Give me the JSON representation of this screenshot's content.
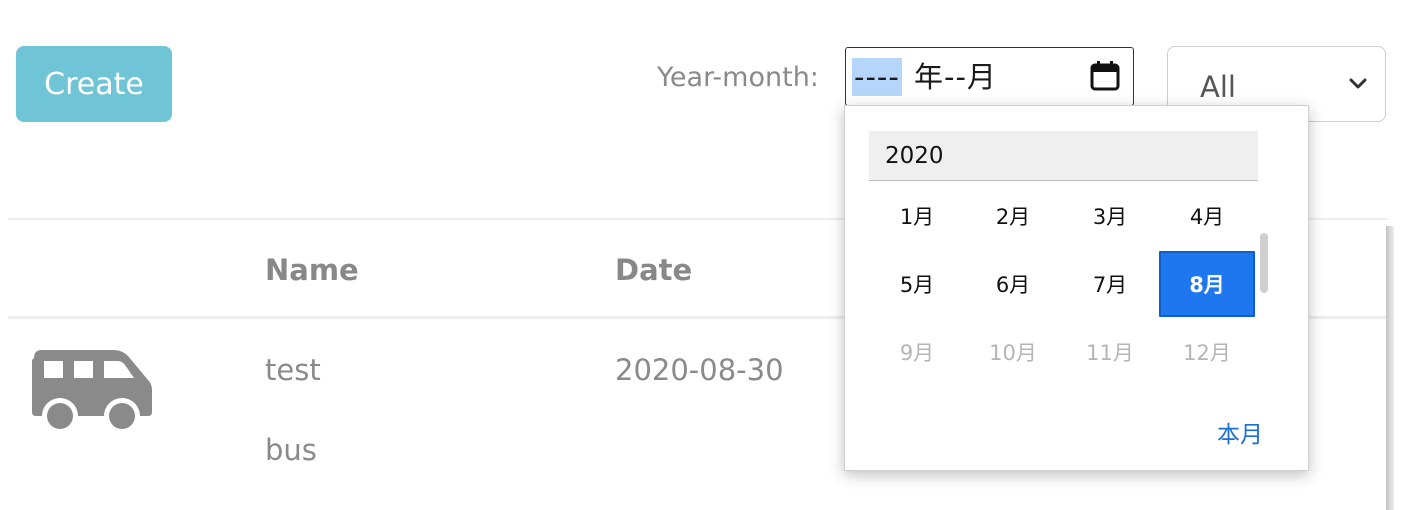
{
  "toolbar": {
    "create_label": "Create",
    "year_month_label": "Year-month:",
    "month_input": {
      "year_segment": "----",
      "rest_segments": "年--月"
    },
    "filter_select": {
      "selected": "All"
    }
  },
  "table": {
    "columns": [
      "",
      "Name",
      "Date"
    ],
    "rows": [
      {
        "icon": "bus-icon",
        "name": "test",
        "date": "2020-08-30",
        "type": "bus"
      }
    ]
  },
  "month_picker": {
    "year": "2020",
    "months": [
      {
        "label": "1月",
        "state": "normal"
      },
      {
        "label": "2月",
        "state": "normal"
      },
      {
        "label": "3月",
        "state": "normal"
      },
      {
        "label": "4月",
        "state": "normal"
      },
      {
        "label": "5月",
        "state": "normal"
      },
      {
        "label": "6月",
        "state": "normal"
      },
      {
        "label": "7月",
        "state": "normal"
      },
      {
        "label": "8月",
        "state": "selected"
      },
      {
        "label": "9月",
        "state": "disabled"
      },
      {
        "label": "10月",
        "state": "disabled"
      },
      {
        "label": "11月",
        "state": "disabled"
      },
      {
        "label": "12月",
        "state": "disabled"
      }
    ],
    "this_month_label": "本月"
  },
  "colors": {
    "create_button": "#6fc4d6",
    "selected_month": "#1f77f0",
    "link": "#1a6fd0",
    "muted_text": "#8a8a8a"
  }
}
